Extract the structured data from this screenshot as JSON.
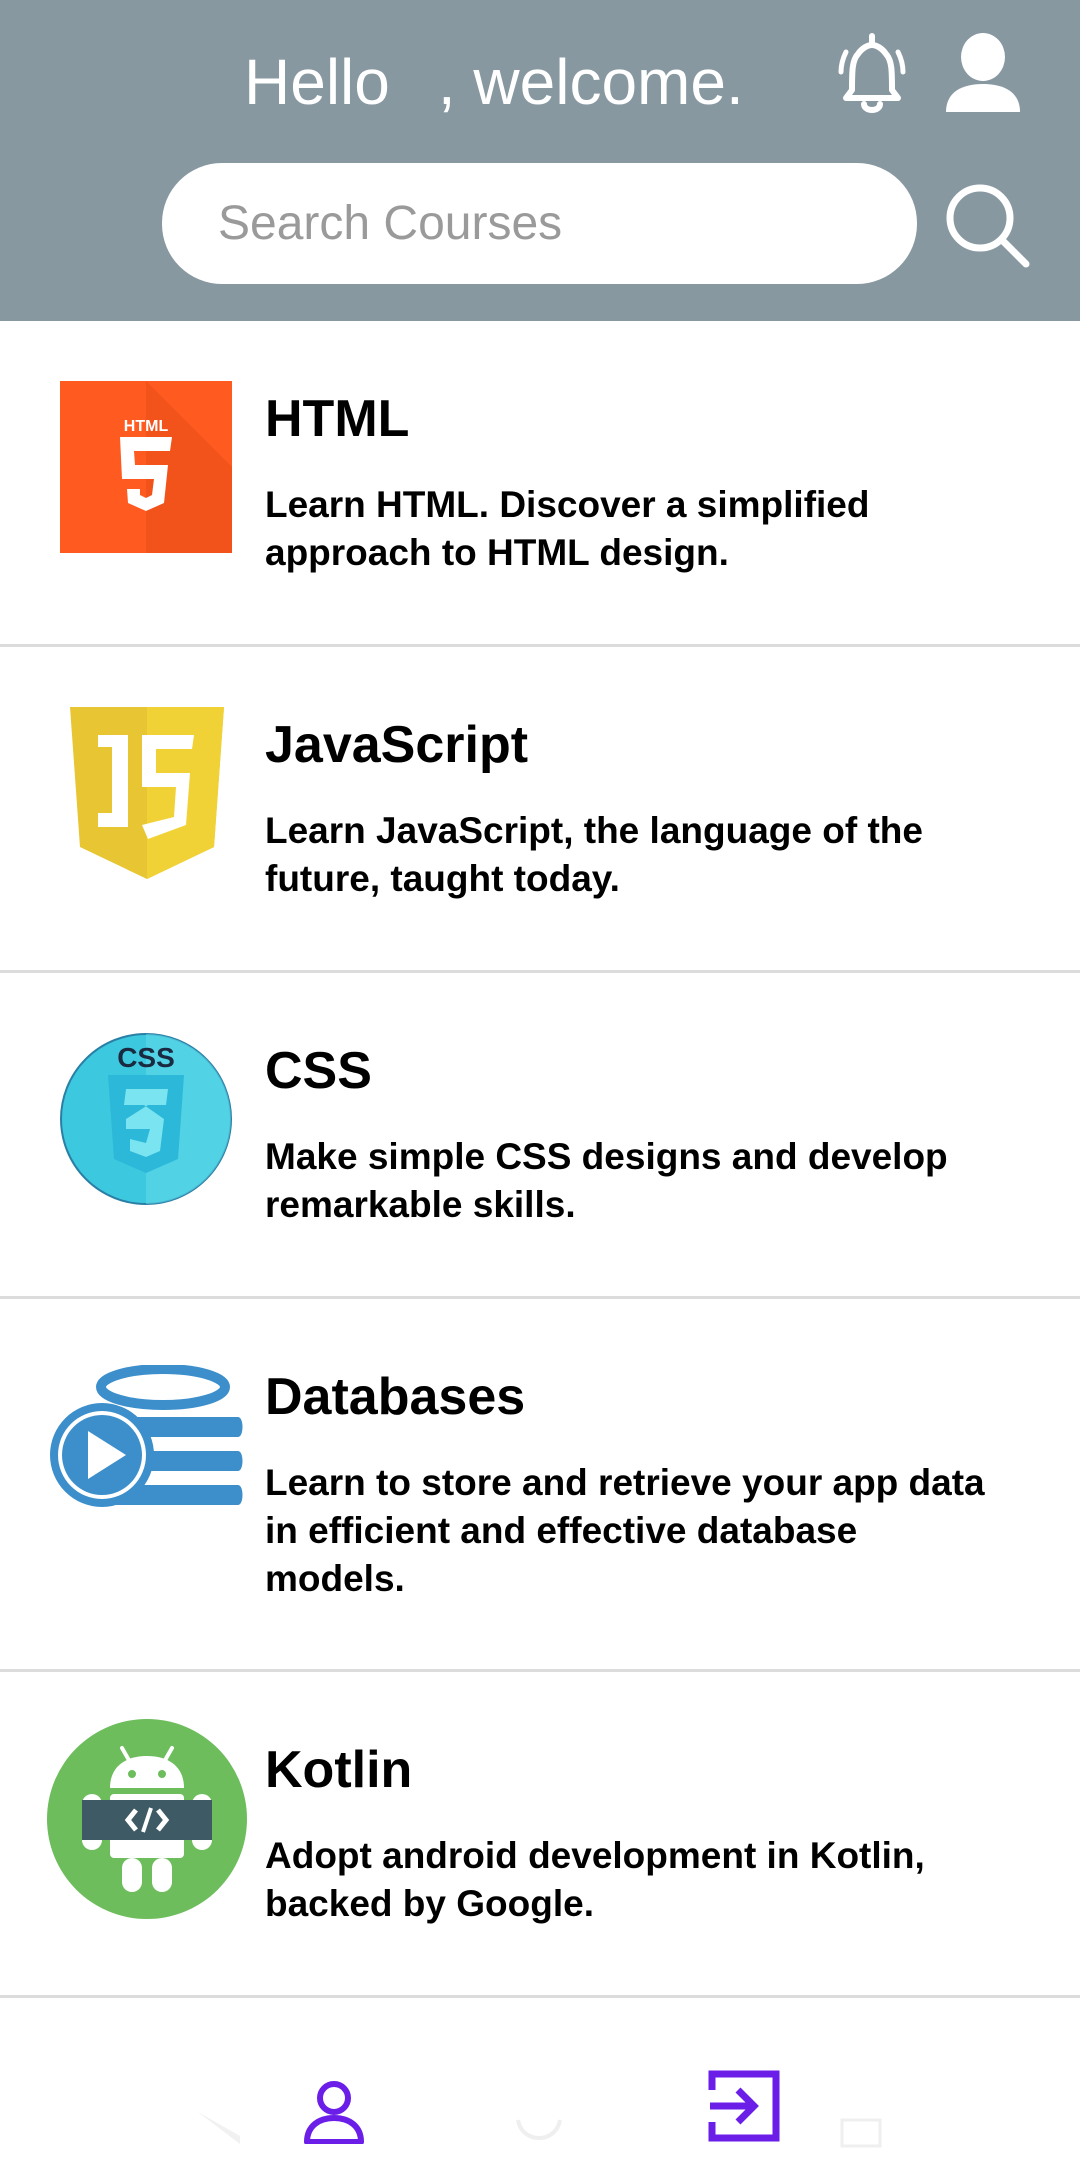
{
  "header": {
    "greeting": "Hello",
    "welcome": ", welcome.",
    "search_placeholder": "Search Courses",
    "bell_icon": "bell-icon",
    "avatar_icon": "user-avatar-icon",
    "search_icon": "search-icon"
  },
  "courses": [
    {
      "title": "HTML",
      "description": "Learn HTML. Discover a simplified approach to HTML design.",
      "icon": "html5-logo-icon"
    },
    {
      "title": "JavaScript",
      "description": "Learn JavaScript, the language of the future, taught today.",
      "icon": "js-logo-icon"
    },
    {
      "title": "CSS",
      "description": "Make simple CSS designs and develop remarkable skills.",
      "icon": "css3-logo-icon"
    },
    {
      "title": "Databases",
      "description": "Learn to store and retrieve your app data in efficient and effective database models.",
      "icon": "database-play-icon"
    },
    {
      "title": "Kotlin",
      "description": "Adopt android development in Kotlin, backed by Google.",
      "icon": "android-code-icon"
    }
  ],
  "bottom_nav": {
    "profile_icon": "profile-icon",
    "logout_icon": "logout-icon"
  },
  "colors": {
    "header_bg": "#8798a1",
    "accent": "#6a1ee8",
    "html_orange": "#ff5a1f",
    "js_yellow": "#e8c533",
    "css_cyan": "#3cc8de",
    "db_blue": "#3d8fcb",
    "android_green": "#6dbd5c"
  }
}
